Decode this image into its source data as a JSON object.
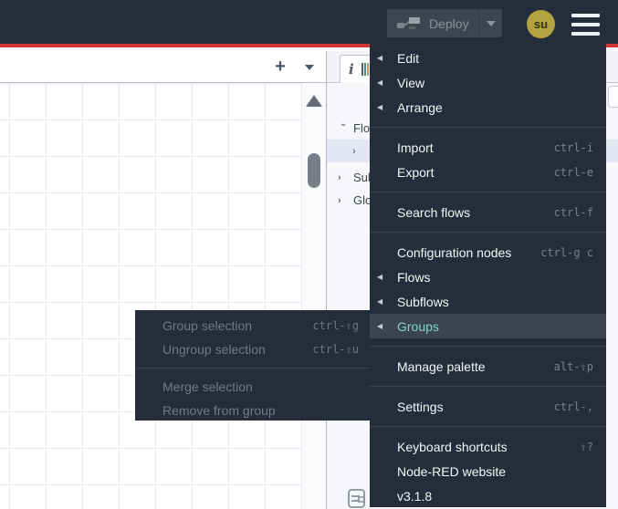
{
  "header": {
    "deploy_label": "Deploy",
    "avatar_initials": "su"
  },
  "workspace_tabs": {
    "add_label": "+"
  },
  "sidebar": {
    "info_tab_glyph": "i",
    "tree": [
      {
        "label": "Flows"
      },
      {
        "label": ""
      },
      {
        "label": "Subflows"
      },
      {
        "label": "Global Configuration Nodes"
      }
    ]
  },
  "menu": {
    "items": [
      {
        "label": "Edit"
      },
      {
        "label": "View"
      },
      {
        "label": "Arrange"
      },
      {
        "label": "Import",
        "shortcut": "ctrl-i"
      },
      {
        "label": "Export",
        "shortcut": "ctrl-e"
      },
      {
        "label": "Search flows",
        "shortcut": "ctrl-f"
      },
      {
        "label": "Configuration nodes",
        "shortcut": "ctrl-g c"
      },
      {
        "label": "Flows"
      },
      {
        "label": "Subflows"
      },
      {
        "label": "Groups"
      },
      {
        "label": "Manage palette",
        "shortcut": "alt-⇧p"
      },
      {
        "label": "Settings",
        "shortcut": "ctrl-,"
      },
      {
        "label": "Keyboard shortcuts",
        "shortcut": "⇧?"
      },
      {
        "label": "Node-RED website"
      },
      {
        "label": "v3.1.8"
      }
    ]
  },
  "groups_submenu": {
    "items": [
      {
        "label": "Group selection",
        "shortcut": "ctrl-⇧g"
      },
      {
        "label": "Ungroup selection",
        "shortcut": "ctrl-⇧u"
      },
      {
        "label": "Merge selection"
      },
      {
        "label": "Remove from group"
      }
    ]
  },
  "colors": {
    "header_bg": "#232d3b",
    "accent_red": "#d23535",
    "menu_active_text": "#7fd4cc",
    "avatar_bg": "#b2a33f"
  }
}
